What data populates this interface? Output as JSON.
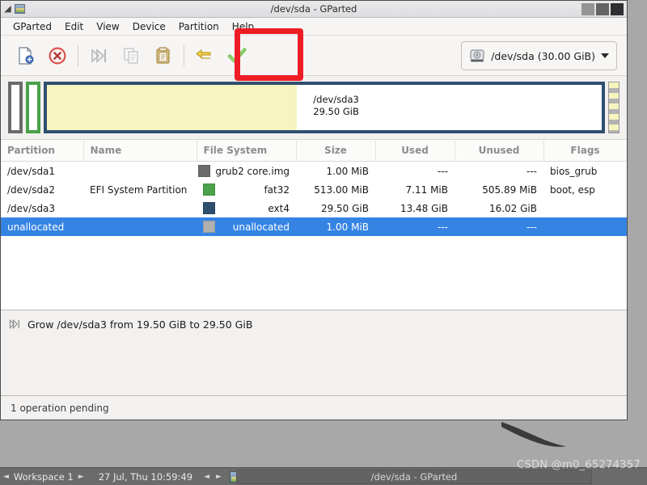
{
  "window": {
    "title": "/dev/sda - GParted",
    "titlebar_icons": [
      "menu-icon",
      "app-icon"
    ],
    "buttons": [
      {
        "name": "minimize",
        "color": "#949494"
      },
      {
        "name": "maximize",
        "color": "#636363"
      },
      {
        "name": "close",
        "color": "#2f2f31"
      }
    ]
  },
  "menubar": {
    "items": [
      {
        "label": "GParted"
      },
      {
        "label": "Edit"
      },
      {
        "label": "View"
      },
      {
        "label": "Device"
      },
      {
        "label": "Partition"
      },
      {
        "label": "Help"
      }
    ]
  },
  "toolbar": {
    "buttons": [
      {
        "name": "new-partition-icon",
        "label": "New",
        "enabled": true
      },
      {
        "name": "delete-partition-icon",
        "label": "Delete",
        "enabled": true
      },
      {
        "name": "resize-move-icon",
        "label": "Resize/Move",
        "enabled": false
      },
      {
        "name": "copy-icon",
        "label": "Copy",
        "enabled": false
      },
      {
        "name": "paste-icon",
        "label": "Paste",
        "enabled": true
      },
      {
        "name": "undo-icon",
        "label": "Undo All Operations",
        "enabled": true
      },
      {
        "name": "apply-icon",
        "label": "Apply All Operations",
        "enabled": true
      }
    ],
    "device_selector": {
      "label": "/dev/sda (30.00 GiB)",
      "icon": "harddisk-icon"
    }
  },
  "annotation": {
    "highlight_color": "#ee1c25",
    "target": "apply-all-operations-button"
  },
  "graphic": {
    "partitions": [
      {
        "name": "sda1",
        "border_color": "#6b6b6b",
        "fill": "#ffffff"
      },
      {
        "name": "sda2",
        "border_color": "#4aa14a",
        "fill": "#ffffff"
      },
      {
        "name": "sda3",
        "border_color": "#2f4f6f",
        "used_fill": "#f6f4bf",
        "unused_fill": "#ffffff",
        "label_line1": "/dev/sda3",
        "label_line2": "29.50 GiB"
      },
      {
        "name": "unallocated",
        "pattern": "hatched-grey-yellow"
      }
    ]
  },
  "table": {
    "columns": [
      "Partition",
      "Name",
      "File System",
      "Size",
      "Used",
      "Unused",
      "Flags"
    ],
    "rows": [
      {
        "partition": "/dev/sda1",
        "name": "",
        "swatch": "#6b6b6b",
        "filesystem": "grub2 core.img",
        "fs_align": "left",
        "size": "1.00 MiB",
        "used": "---",
        "unused": "---",
        "flags": "bios_grub",
        "selected": false
      },
      {
        "partition": "/dev/sda2",
        "name": "EFI System Partition",
        "swatch": "#4aa14a",
        "filesystem": "fat32",
        "fs_align": "right",
        "size": "513.00 MiB",
        "used": "7.11 MiB",
        "unused": "505.89 MiB",
        "flags": "boot, esp",
        "selected": false
      },
      {
        "partition": "/dev/sda3",
        "name": "",
        "swatch": "#2f4f6f",
        "filesystem": "ext4",
        "fs_align": "right",
        "size": "29.50 GiB",
        "used": "13.48 GiB",
        "unused": "16.02 GiB",
        "flags": "",
        "selected": false
      },
      {
        "partition": "unallocated",
        "name": "",
        "swatch": "#b0b0b0",
        "filesystem": "unallocated",
        "fs_align": "right",
        "size": "1.00 MiB",
        "used": "---",
        "unused": "---",
        "flags": "",
        "selected": true
      }
    ]
  },
  "operations": {
    "items": [
      {
        "icon": "resize-grow-icon",
        "text": "Grow /dev/sda3 from 19.50 GiB to 29.50 GiB"
      }
    ]
  },
  "statusbar": {
    "text": "1 operation pending"
  },
  "taskbar": {
    "prev_arrow": "◄",
    "next_arrow": "►",
    "workspace": "Workspace 1",
    "clock": "27 Jul, Thu 10:59:49",
    "left_arrow": "◄",
    "right_arrow": "►",
    "window_button": "/dev/sda - GParted"
  },
  "watermark": {
    "text": "CSDN @m0_65274357"
  }
}
